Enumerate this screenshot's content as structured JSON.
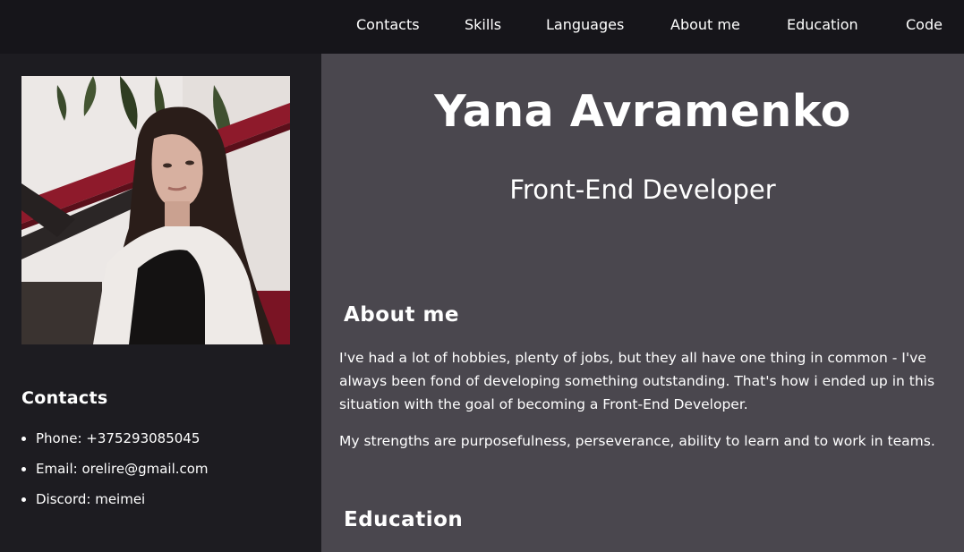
{
  "nav": {
    "items": [
      {
        "label": "Contacts"
      },
      {
        "label": "Skills"
      },
      {
        "label": "Languages"
      },
      {
        "label": "About me"
      },
      {
        "label": "Education"
      },
      {
        "label": "Code"
      }
    ]
  },
  "sidebar": {
    "contacts_heading": "Contacts",
    "contacts": [
      {
        "text": "Phone: +375293085045"
      },
      {
        "text": "Email: orelire@gmail.com"
      },
      {
        "text": "Discord: meimei"
      }
    ]
  },
  "main": {
    "name": "Yana Avramenko",
    "role": "Front-End Developer",
    "about_heading": "About me",
    "about_paragraphs": [
      "I've had a lot of hobbies, plenty of jobs, but they all have one thing in common - I've always been fond of developing something outstanding. That's how i ended up in this situation with the goal of becoming a Front-End Developer.",
      "My strengths are purposefulness, perseverance, ability to learn and to work in teams."
    ],
    "education_heading": "Education"
  },
  "colors": {
    "nav_bg": "#16151a",
    "sidebar_bg": "#1d1c21",
    "main_bg": "#4a474e",
    "text": "#ffffff"
  }
}
